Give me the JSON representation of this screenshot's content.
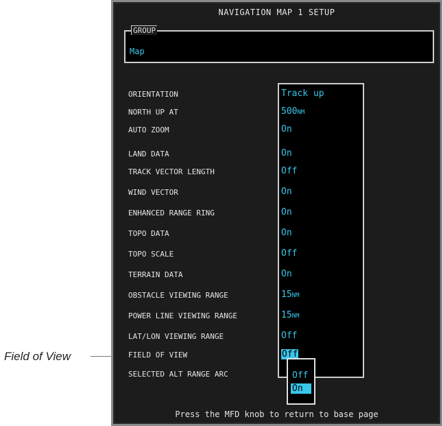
{
  "callout": {
    "label": "Field of View"
  },
  "window": {
    "title": "NAVIGATION MAP 1 SETUP"
  },
  "group": {
    "label": "GROUP",
    "value": "Map"
  },
  "settings": [
    {
      "label": "ORIENTATION",
      "value": "Track up"
    },
    {
      "label": "NORTH UP AT",
      "value": "500",
      "unit": "NM"
    },
    {
      "label": "AUTO ZOOM",
      "value": "On"
    },
    {
      "label": "LAND DATA",
      "value": "On"
    },
    {
      "label": "TRACK VECTOR LENGTH",
      "value": "Off"
    },
    {
      "label": "WIND VECTOR",
      "value": "On"
    },
    {
      "label": "ENHANCED RANGE RING",
      "value": "On"
    },
    {
      "label": "TOPO DATA",
      "value": "On"
    },
    {
      "label": "TOPO SCALE",
      "value": "Off"
    },
    {
      "label": "TERRAIN DATA",
      "value": "On"
    },
    {
      "label": "OBSTACLE VIEWING RANGE",
      "value": "15",
      "unit": "NM"
    },
    {
      "label": "POWER LINE VIEWING RANGE",
      "value": "15",
      "unit": "NM"
    },
    {
      "label": "LAT/LON VIEWING RANGE",
      "value": "Off"
    },
    {
      "label": "FIELD OF VIEW",
      "value": "Off"
    },
    {
      "label": "SELECTED ALT RANGE ARC",
      "value": ""
    }
  ],
  "popup": {
    "options": [
      "Off",
      "On"
    ],
    "selected": "On"
  },
  "footer": {
    "text": "Press the MFD knob to return to base page"
  },
  "colors": {
    "value_cyan": "#39c6ea",
    "panel_bg": "#1c1c1c",
    "field_bg": "#000000"
  }
}
